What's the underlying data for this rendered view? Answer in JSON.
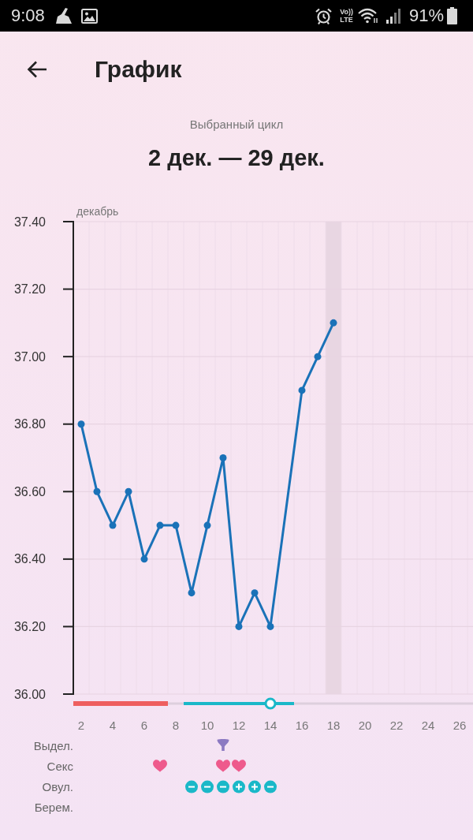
{
  "status_bar": {
    "time": "9:08",
    "volte": [
      "Vo))",
      "LTE"
    ],
    "battery": "91%"
  },
  "app_bar": {
    "title": "График"
  },
  "cycle": {
    "caption": "Выбранный цикл",
    "range": "2 дек. — 29 дек."
  },
  "chart": {
    "month_label": "декабрь",
    "chart_data": {
      "type": "line",
      "x": [
        2,
        3,
        4,
        5,
        6,
        7,
        8,
        9,
        10,
        11,
        12,
        13,
        14,
        16,
        17,
        18
      ],
      "series": [
        {
          "color": "#1a72b8",
          "marker": "circle",
          "values": [
            36.8,
            36.6,
            36.5,
            36.6,
            36.4,
            36.5,
            36.5,
            36.3,
            36.5,
            36.7,
            36.2,
            36.3,
            36.2,
            36.9,
            37.0,
            37.1
          ]
        }
      ],
      "xlim": [
        1.5,
        26.85
      ],
      "ylim": [
        36,
        37.4
      ],
      "xticks": [
        2,
        4,
        6,
        8,
        10,
        12,
        14,
        16,
        18,
        20,
        22,
        24,
        26
      ],
      "yticks": [
        {
          "value": 36,
          "label": "36.00"
        },
        {
          "value": 36.2,
          "label": "36.20"
        },
        {
          "value": 36.4,
          "label": "36.40"
        },
        {
          "value": 36.6,
          "label": "36.60"
        },
        {
          "value": 36.8,
          "label": "36.80"
        },
        {
          "value": 37,
          "label": "37.00"
        },
        {
          "value": 37.2,
          "label": "37.20"
        },
        {
          "value": 37.4,
          "label": "37.40"
        }
      ],
      "grid": true,
      "bands": [
        {
          "axis": "x",
          "from": 17.5,
          "to": 18.5,
          "color": "#e8d6e2"
        }
      ]
    },
    "phase_days": [
      {
        "kind": "period"
      },
      {
        "kind": "period"
      },
      {
        "kind": "period"
      },
      {
        "kind": "period"
      },
      {
        "kind": "period"
      },
      {
        "kind": "period"
      },
      {
        "kind": "none"
      },
      {
        "kind": "fertile"
      },
      {
        "kind": "fertile"
      },
      {
        "kind": "fertile"
      },
      {
        "kind": "fertile"
      },
      {
        "kind": "fertile"
      },
      {
        "kind": "ovulation"
      },
      {
        "kind": "fertile"
      }
    ],
    "tracks": [
      {
        "label": "Выдел.",
        "days": [
          {
            "kind": "none"
          },
          {
            "kind": "none"
          },
          {
            "kind": "none"
          },
          {
            "kind": "none"
          },
          {
            "kind": "none"
          },
          {
            "kind": "none"
          },
          {
            "kind": "none"
          },
          {
            "kind": "none"
          },
          {
            "kind": "none"
          },
          {
            "kind": "discharge"
          }
        ]
      },
      {
        "label": "Секс",
        "days": [
          {
            "kind": "none"
          },
          {
            "kind": "none"
          },
          {
            "kind": "none"
          },
          {
            "kind": "none"
          },
          {
            "kind": "none"
          },
          {
            "kind": "heart"
          },
          {
            "kind": "none"
          },
          {
            "kind": "none"
          },
          {
            "kind": "none"
          },
          {
            "kind": "heart"
          },
          {
            "kind": "heart"
          }
        ]
      },
      {
        "label": "Овул.",
        "days": [
          {
            "kind": "none"
          },
          {
            "kind": "none"
          },
          {
            "kind": "none"
          },
          {
            "kind": "none"
          },
          {
            "kind": "none"
          },
          {
            "kind": "none"
          },
          {
            "kind": "none"
          },
          {
            "kind": "negative"
          },
          {
            "kind": "negative"
          },
          {
            "kind": "negative"
          },
          {
            "kind": "positive"
          },
          {
            "kind": "positive"
          },
          {
            "kind": "negative"
          }
        ]
      },
      {
        "label": "Берем."
      }
    ]
  }
}
